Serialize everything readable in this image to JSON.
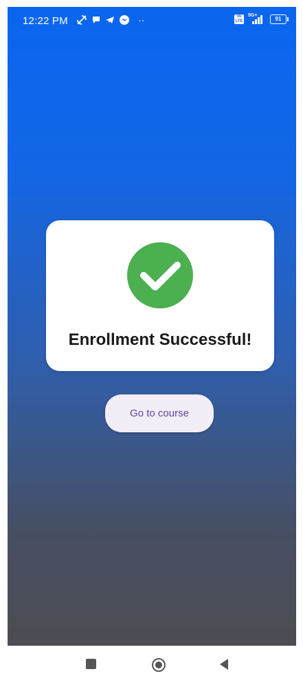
{
  "status_bar": {
    "time": "12:22 PM",
    "more": "··",
    "volte_label": "Vo LTE",
    "network_label": "5G+",
    "battery_level": "91"
  },
  "dialog": {
    "title": "Enrollment Successful!",
    "icon": "check-circle-icon",
    "icon_color": "#4caf50"
  },
  "actions": {
    "go_to_course_label": "Go to course"
  },
  "theme": {
    "gradient_top": "#0a66ef",
    "gradient_bottom": "#4d4d52",
    "button_background": "#f3edf7",
    "button_text": "#5a4aa0"
  },
  "navigation": {
    "recents": "recents-square-icon",
    "home": "home-circle-icon",
    "back": "back-triangle-icon"
  }
}
